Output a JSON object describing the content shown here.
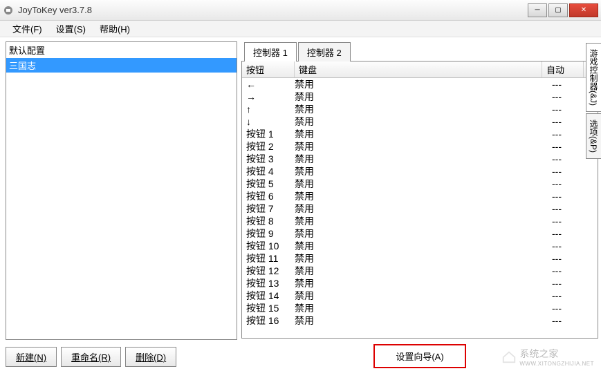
{
  "window": {
    "title": "JoyToKey ver3.7.8"
  },
  "menu": {
    "file": "文件(F)",
    "settings": "设置(S)",
    "help": "帮助(H)"
  },
  "profiles": {
    "header": "默认配置",
    "items": [
      "三国志"
    ]
  },
  "buttons": {
    "new": "新建(N)",
    "rename": "重命名(R)",
    "delete": "删除(D)",
    "wizard": "设置向导(A)"
  },
  "tabs": {
    "controller1": "控制器 1",
    "controller2": "控制器 2"
  },
  "sideTabs": {
    "controller": "游戏控制器(&J)",
    "options": "选项(&P)"
  },
  "table": {
    "headers": {
      "button": "按钮",
      "keyboard": "键盘",
      "auto": "自动"
    },
    "rows": [
      {
        "button": "←",
        "key": "禁用",
        "auto": "---"
      },
      {
        "button": "→",
        "key": "禁用",
        "auto": "---"
      },
      {
        "button": "↑",
        "key": "禁用",
        "auto": "---"
      },
      {
        "button": "↓",
        "key": "禁用",
        "auto": "---"
      },
      {
        "button": "按钮 1",
        "key": "禁用",
        "auto": "---"
      },
      {
        "button": "按钮 2",
        "key": "禁用",
        "auto": "---"
      },
      {
        "button": "按钮 3",
        "key": "禁用",
        "auto": "---"
      },
      {
        "button": "按钮 4",
        "key": "禁用",
        "auto": "---"
      },
      {
        "button": "按钮 5",
        "key": "禁用",
        "auto": "---"
      },
      {
        "button": "按钮 6",
        "key": "禁用",
        "auto": "---"
      },
      {
        "button": "按钮 7",
        "key": "禁用",
        "auto": "---"
      },
      {
        "button": "按钮 8",
        "key": "禁用",
        "auto": "---"
      },
      {
        "button": "按钮 9",
        "key": "禁用",
        "auto": "---"
      },
      {
        "button": "按钮 10",
        "key": "禁用",
        "auto": "---"
      },
      {
        "button": "按钮 11",
        "key": "禁用",
        "auto": "---"
      },
      {
        "button": "按钮 12",
        "key": "禁用",
        "auto": "---"
      },
      {
        "button": "按钮 13",
        "key": "禁用",
        "auto": "---"
      },
      {
        "button": "按钮 14",
        "key": "禁用",
        "auto": "---"
      },
      {
        "button": "按钮 15",
        "key": "禁用",
        "auto": "---"
      },
      {
        "button": "按钮 16",
        "key": "禁用",
        "auto": "---"
      }
    ]
  },
  "watermark": {
    "text": "系统之家",
    "url": "WWW.XITONGZHIJIA.NET"
  }
}
